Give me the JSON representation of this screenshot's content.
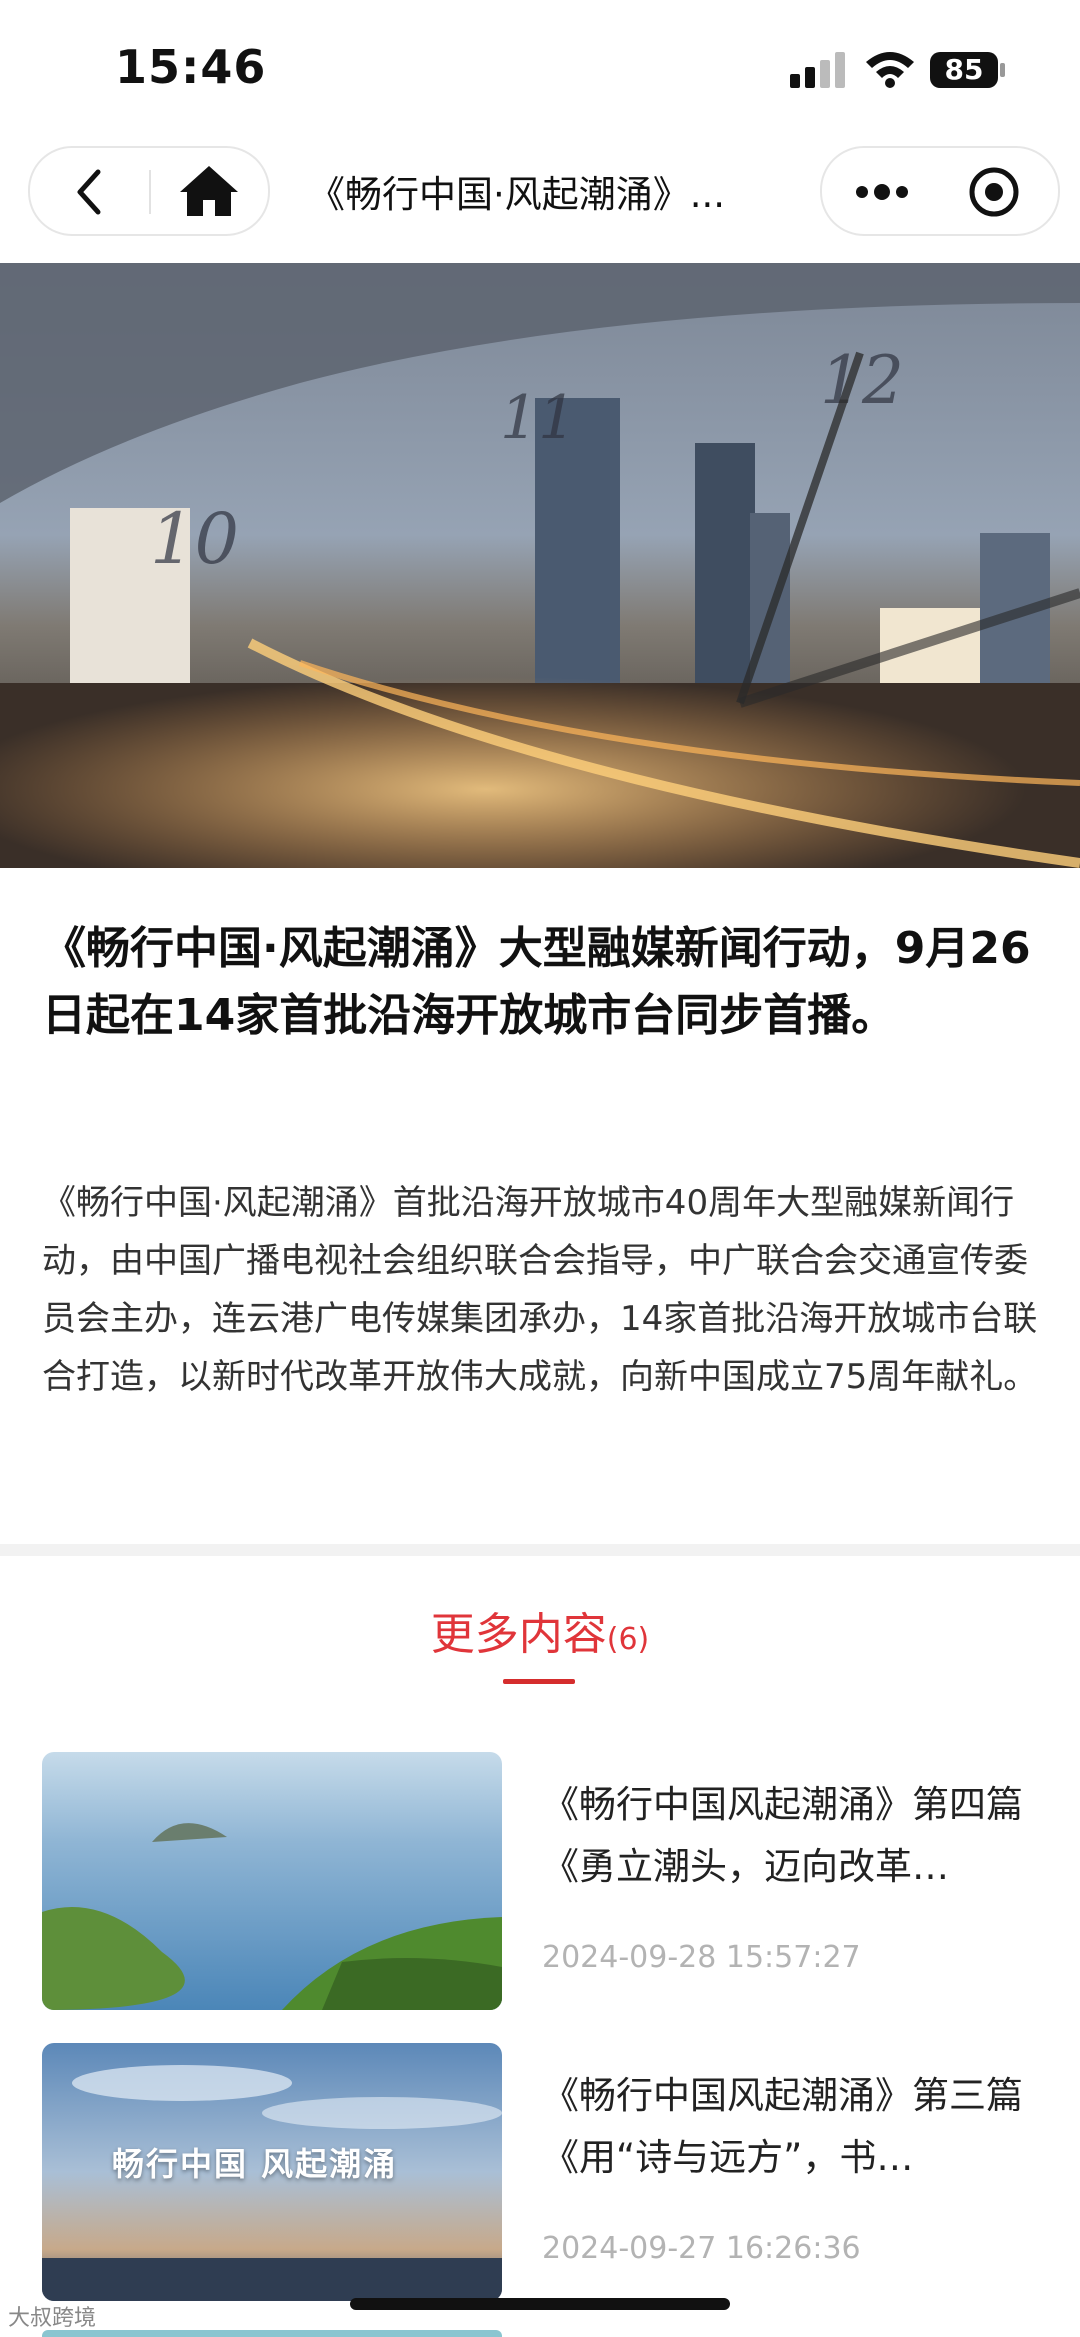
{
  "status_bar": {
    "time": "15:46",
    "battery": "85"
  },
  "nav": {
    "title": "《畅行中国·风起潮涌》..."
  },
  "article": {
    "headline": "《畅行中国·风起潮涌》大型融媒新闻行动，9月26日起在14家首批沿海开放城市台同步首播。",
    "summary": "《畅行中国·风起潮涌》首批沿海开放城市40周年大型融媒新闻行动，由中国广播电视社会组织联合会指导，中广联合会交通宣传委员会主办，连云港广电传媒集团承办，14家首批沿海开放城市台联合打造，以新时代改革开放伟大成就，向新中国成立75周年献礼。"
  },
  "more": {
    "title": "更多内容",
    "count": "(6)",
    "items": [
      {
        "title": "《畅行中国风起潮涌》第四篇《勇立潮头，迈向改革…",
        "date": "2024-09-28 15:57:27"
      },
      {
        "title": "《畅行中国风起潮涌》第三篇《用“诗与远方”，书…",
        "date": "2024-09-27 16:26:36",
        "thumb_text": "畅行中国 风起潮涌"
      }
    ]
  },
  "watermark": "大叔跨境",
  "colors": {
    "accent": "#e0353a",
    "text": "#111111",
    "muted": "#b3b3b3"
  }
}
